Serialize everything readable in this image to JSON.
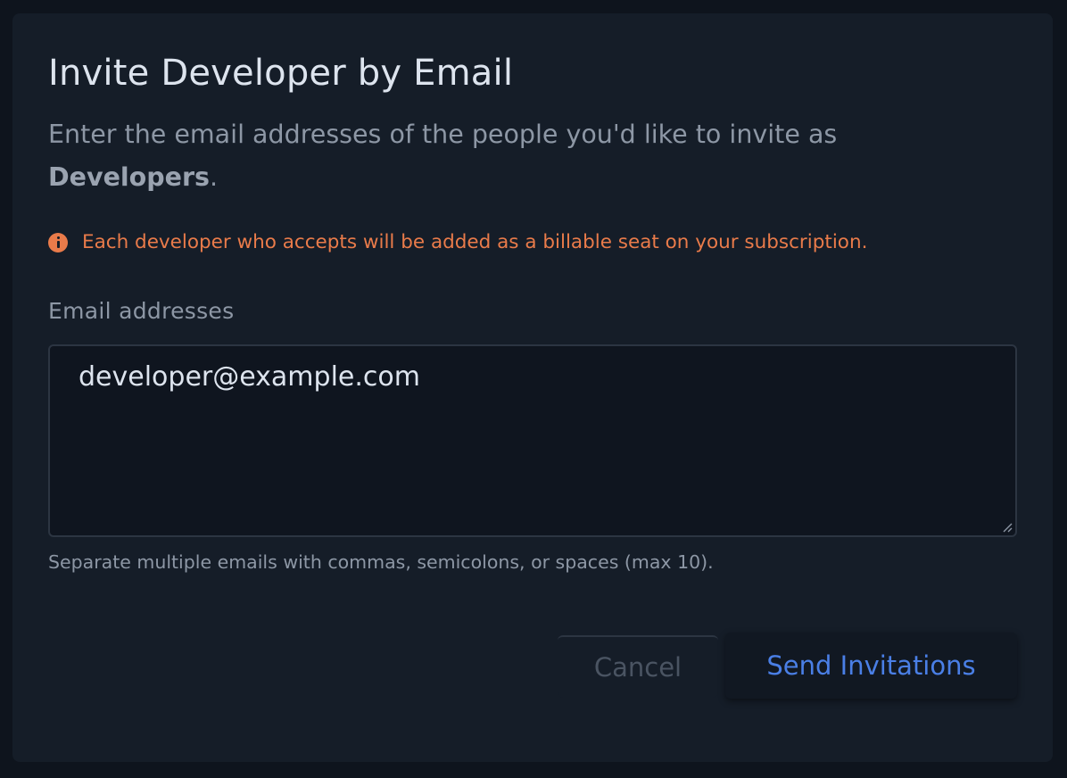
{
  "dialog": {
    "title": "Invite Developer by Email",
    "description_prefix": "Enter the email addresses of the people you'd like to invite as ",
    "description_role": "Developers",
    "description_suffix": ".",
    "warning": {
      "icon": "info-circle-icon",
      "text": "Each developer who accepts will be added as a billable seat on your subscription.",
      "color": "#e97b4a"
    },
    "email_field": {
      "label": "Email addresses",
      "value": "developer@example.com",
      "helper": "Separate multiple emails with commas, semicolons, or spaces (max 10)."
    },
    "actions": {
      "cancel_label": "Cancel",
      "send_label": "Send Invitations"
    }
  }
}
